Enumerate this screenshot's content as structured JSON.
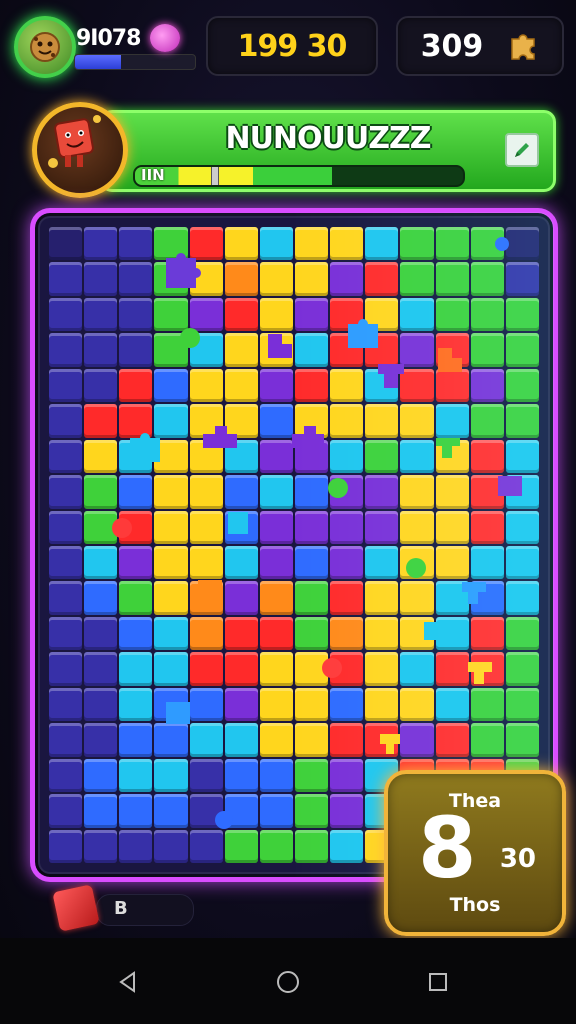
{
  "hud": {
    "player_score": "9I078",
    "player_progress": 0.38,
    "timer_value": "199 30",
    "pieces_count": "309"
  },
  "level": {
    "title": "NUNOUUZZZ",
    "progress_label": "IIN",
    "progress": 0.6
  },
  "board": {
    "columns": 14,
    "rows": 18,
    "palette": {
      "R": "#ff2a2a",
      "Y": "#ffd61d",
      "G": "#3fd13a",
      "B": "#2f6bff",
      "C": "#21c6ef",
      "P": "#7a2fd8",
      "I": "#3730a8",
      "O": "#ff8a1a",
      "D": "#26206e"
    },
    "layout": [
      "DIIGRYCYYCGGGD",
      "IIIGYOYYPRGGGI",
      "IIIGPRYPRYCGGG",
      "IIIGCYYCRRPRGG",
      "IIRBYYPRYCRRPG",
      "IRRCYYBYYYYCGG",
      "IYCYYCPPCGCYRC",
      "IGBYYBCBPPYYRC",
      "IGRYYBPPPPYYRC",
      "ICPYYCPBPCYYCC",
      "IBGYOPOGRYYCBC",
      "IIBCORRGOYYCRG",
      "IICCRRYYRYCRRG",
      "IICBBPYYBYYCGG",
      "IIBBCCYYRRPRGG",
      "IBCCIBBGPCRRRG",
      "IBBBIBBGPCRRRG",
      "IIIIIGGGCYIIIG"
    ]
  },
  "count_panel": {
    "top": "Thea",
    "big": "8",
    "side": "30",
    "bottom": "Thos"
  },
  "powerup": {
    "label": "B"
  },
  "colors": {
    "board_glow_left": "#d94dff",
    "board_glow_right": "#3cf0ff",
    "banner": "#3fcf2e",
    "timer_text": "#ffd21a",
    "count_panel_border": "#f1b43a"
  },
  "icons": {
    "avatar": "cookie-character-icon",
    "gem": "pink-gem-icon",
    "pieces": "gold-puzzle-piece-icon",
    "mascot": "red-cube-mascot-icon",
    "edit": "edit-icon",
    "powerup": "red-cube-icon",
    "nav_back": "back-triangle-icon",
    "nav_home": "home-circle-icon",
    "nav_recent": "recents-square-icon"
  }
}
